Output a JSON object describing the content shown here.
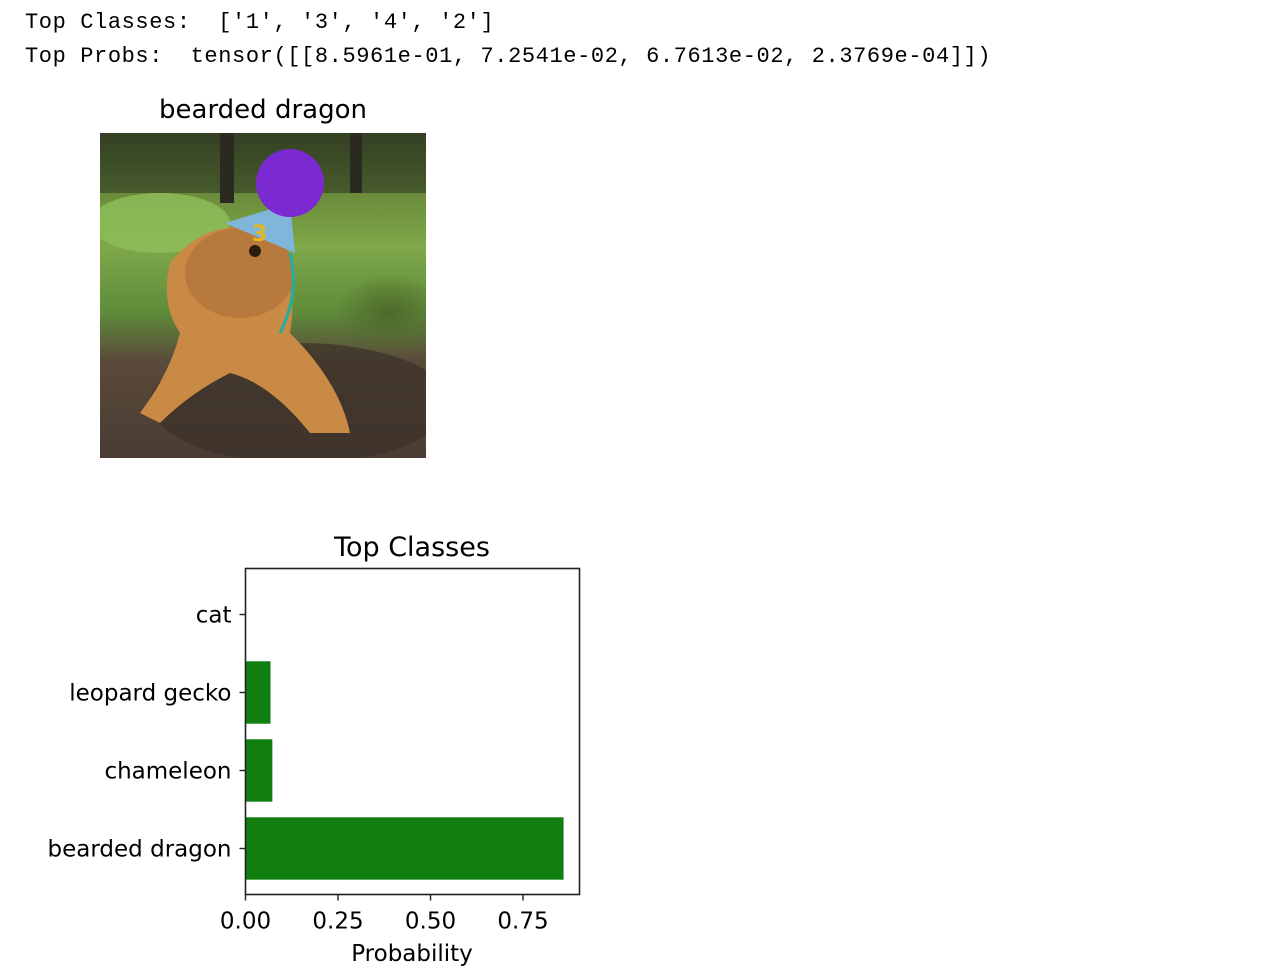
{
  "output": {
    "top_classes_line": "Top Classes:  ['1', '3', '4', '2']",
    "top_probs_line": "Top Probs:  tensor([[8.5961e-01, 7.2541e-02, 6.7613e-02, 2.3769e-04]])"
  },
  "image": {
    "title": "bearded dragon"
  },
  "chart_data": {
    "type": "bar",
    "orientation": "horizontal",
    "title": "Top Classes",
    "xlabel": "Probability",
    "ylabel": "",
    "categories": [
      "bearded dragon",
      "chameleon",
      "leopard gecko",
      "cat"
    ],
    "values": [
      0.85961,
      0.072541,
      0.067613,
      0.00023769
    ],
    "xlim": [
      0,
      0.9026
    ],
    "xticks": [
      "0.00",
      "0.25",
      "0.50",
      "0.75"
    ],
    "bar_color": "#107f10",
    "grid": false
  }
}
